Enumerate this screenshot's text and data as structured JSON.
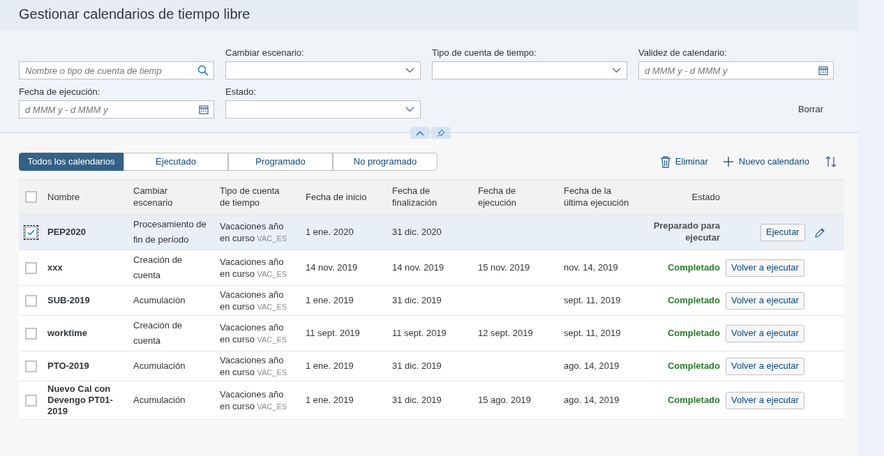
{
  "page": {
    "title": "Gestionar calendarios de tiempo libre"
  },
  "filters": {
    "search": {
      "placeholder": "Nombre o tipo de cuenta de tiemp"
    },
    "fields": [
      {
        "label": "Cambiar escenario:",
        "kind": "select"
      },
      {
        "label": "Tipo de cuenta de tiempo:",
        "kind": "select"
      },
      {
        "label": "Validez de calendario:",
        "kind": "date",
        "placeholder": "d MMM y - d MMM y"
      },
      {
        "label": "Fecha de ejecución:",
        "kind": "date",
        "placeholder": "d MMM y - d MMM y"
      },
      {
        "label": "Estado:",
        "kind": "select"
      }
    ],
    "clear_button": "Borrar"
  },
  "tabs": [
    {
      "label": "Todos los calendarios",
      "selected": true
    },
    {
      "label": "Ejecutado",
      "selected": false
    },
    {
      "label": "Programado",
      "selected": false
    },
    {
      "label": "No programado",
      "selected": false
    }
  ],
  "toolbar": {
    "delete": "Eliminar",
    "new": "Nuevo calendario"
  },
  "table": {
    "columns": [
      "Nombre",
      "Cambiar escenario",
      "Tipo de cuenta de tiempo",
      "Fecha de inicio",
      "Fecha de finalización",
      "Fecha de ejecución",
      "Fecha de la última ejecución",
      "Estado"
    ],
    "header_checked": false,
    "rows": [
      {
        "checked": true,
        "selected": true,
        "name": "PEP2020",
        "scenario": "Procesamiento de fin de período",
        "type": "Vacaciones año en curso",
        "code": "VAC_ES",
        "start": "1 ene. 2020",
        "end": "31 dic. 2020",
        "status": "Preparado para ejecutar",
        "kind": "ready",
        "action": "Ejecutar",
        "editable": true
      },
      {
        "checked": false,
        "selected": false,
        "name": "xxx",
        "scenario": "Creación de cuenta",
        "type": "Vacaciones año en curso",
        "code": "VAC_ES",
        "start": "14 nov. 2019",
        "end": "14 nov. 2019",
        "run": "15 nov. 2019",
        "last_run": "nov. 14, 2019",
        "status": "Completado",
        "kind": "done",
        "action": "Volver a ejecutar",
        "editable": false
      },
      {
        "checked": false,
        "selected": false,
        "name": "SUB-2019",
        "scenario": "Acumulación",
        "type": "Vacaciones año en curso",
        "code": "VAC_ES",
        "start": "1 ene. 2019",
        "end": "31 dic. 2019",
        "last_run": "sept. 11, 2019",
        "status": "Completado",
        "kind": "done",
        "action": "Volver a ejecutar",
        "editable": false
      },
      {
        "checked": false,
        "selected": false,
        "name": "worktime",
        "scenario": "Creación de cuenta",
        "type": "Vacaciones año en curso",
        "code": "VAC_ES",
        "start": "11 sept. 2019",
        "end": "11 sept. 2019",
        "run": "12 sept. 2019",
        "last_run": "sept. 11, 2019",
        "status": "Completado",
        "kind": "done",
        "action": "Volver a ejecutar",
        "editable": false
      },
      {
        "checked": false,
        "selected": false,
        "name": "PTO-2019",
        "scenario": "Acumulación",
        "type": "Vacaciones año en curso",
        "code": "VAC_ES",
        "start": "1 ene. 2019",
        "end": "31 dic. 2019",
        "last_run": "ago. 14, 2019",
        "status": "Completado",
        "kind": "done",
        "action": "Volver a ejecutar",
        "editable": false
      },
      {
        "checked": false,
        "selected": false,
        "name": "Nuevo Cal con Devengo PT01-2019",
        "scenario": "Acumulación",
        "type": "Vacaciones año en curso",
        "code": "VAC_ES",
        "start": "1 ene. 2019",
        "end": "31 dic. 2019",
        "run": "15 ago. 2019",
        "last_run": "ago. 14, 2019",
        "status": "Completado",
        "kind": "done",
        "action": "Volver a ejecutar",
        "editable": false
      }
    ]
  }
}
